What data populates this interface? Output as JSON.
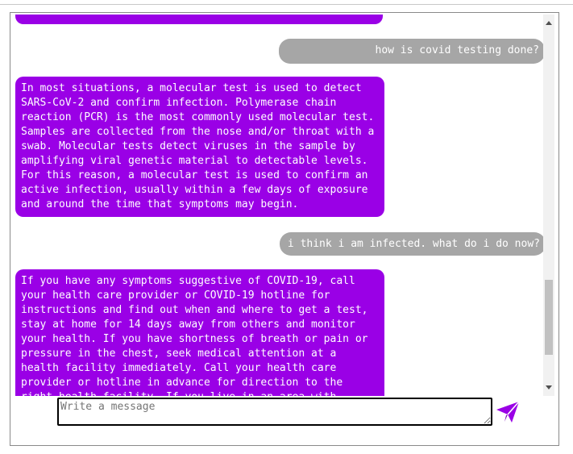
{
  "conversation": {
    "messages": [
      {
        "role": "bot",
        "text": ""
      },
      {
        "role": "user",
        "text": "how is covid testing done?"
      },
      {
        "role": "bot",
        "text": "In most situations, a molecular test is used to detect\nSARS-CoV-2 and confirm infection. Polymerase chain\nreaction (PCR) is the most commonly used molecular test.\nSamples are collected from the nose and/or throat with a\nswab. Molecular tests detect viruses in the sample by\namplifying viral genetic material to detectable levels.\nFor this reason, a molecular test is used to confirm an\nactive infection, usually within a few days of exposure\nand around the time that symptoms may begin."
      },
      {
        "role": "user",
        "text": "i think i am infected. what do i do now?"
      },
      {
        "role": "bot",
        "text": "If you have any symptoms suggestive of COVID-19, call\nyour health care provider or COVID-19 hotline for\ninstructions and find out when and where to get a test,\nstay at home for 14 days away from others and monitor\nyour health. If you have shortness of breath or pain or\npressure in the chest, seek medical attention at a\nhealth facility immediately. Call your health care\nprovider or hotline in advance for direction to the\nright health facility. If you live in an area with"
      }
    ]
  },
  "composer": {
    "placeholder": "Write a message",
    "value": ""
  },
  "icons": {
    "send": "paper-plane-send-icon"
  },
  "colors": {
    "bot_bubble": "#9a00e6",
    "user_bubble": "#a6a6a6",
    "send_icon": "#9a00e6"
  }
}
